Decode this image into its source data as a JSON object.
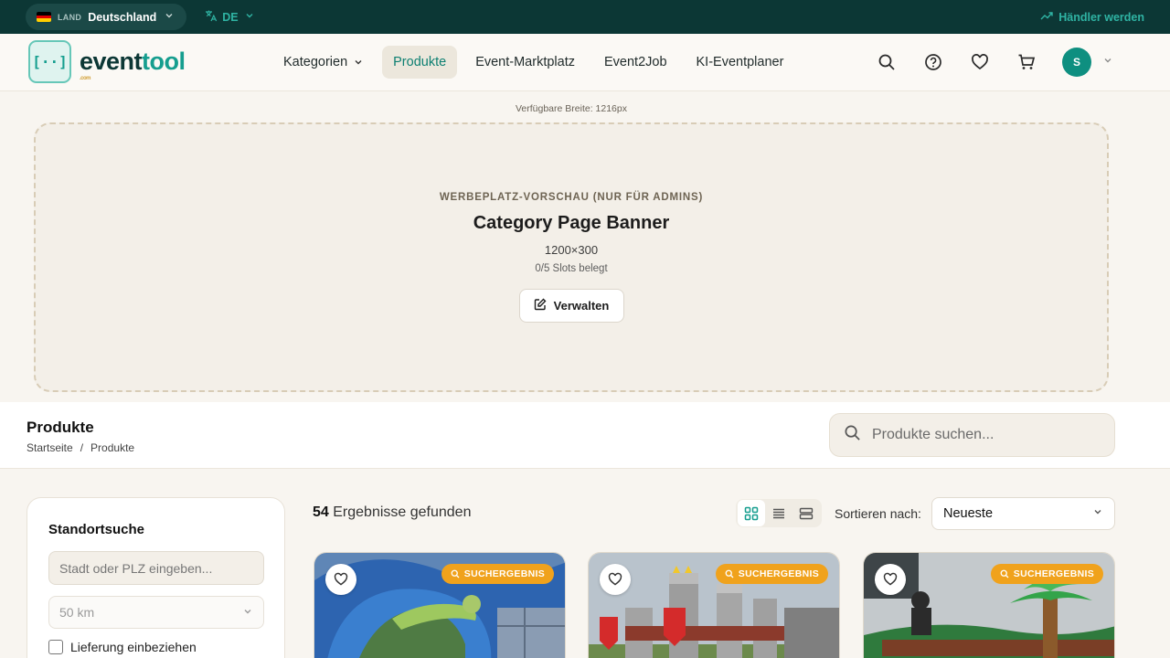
{
  "topbar": {
    "land_label": "LAND",
    "country": "Deutschland",
    "language": "DE",
    "merchant_link": "Händler werden"
  },
  "header": {
    "logo_main": "event",
    "logo_accent": "tool",
    "logo_sub": ".com",
    "nav": [
      {
        "label": "Kategorien",
        "active": false
      },
      {
        "label": "Produkte",
        "active": true
      },
      {
        "label": "Event-Marktplatz",
        "active": false
      },
      {
        "label": "Event2Job",
        "active": false
      },
      {
        "label": "KI-Eventplaner",
        "active": false
      }
    ],
    "avatar_initial": "S"
  },
  "banner": {
    "available_width": "Verfügbare Breite: 1216px",
    "label": "WERBEPLATZ-VORSCHAU (NUR FÜR ADMINS)",
    "title": "Category Page Banner",
    "size": "1200×300",
    "slots": "0/5 Slots belegt",
    "manage_label": "Verwalten"
  },
  "products_header": {
    "title": "Produkte",
    "breadcrumb": [
      "Startseite",
      "/",
      "Produkte"
    ],
    "search_placeholder": "Produkte suchen..."
  },
  "sidebar": {
    "title": "Standortsuche",
    "city_placeholder": "Stadt oder PLZ eingeben...",
    "radius": "50 km",
    "delivery_label": "Lieferung einbeziehen"
  },
  "results": {
    "count": "54",
    "text": "Ergebnisse gefunden",
    "sort_label": "Sortieren nach:",
    "sort_value": "Neueste"
  },
  "cards": [
    {
      "badge": "SUCHERGEBNIS"
    },
    {
      "badge": "SUCHERGEBNIS"
    },
    {
      "badge": "SUCHERGEBNIS"
    }
  ],
  "colors": {
    "brand_dark": "#0c3735",
    "brand_teal": "#169e8f",
    "badge_orange": "#f0a21c",
    "background": "#f8f5f0"
  }
}
